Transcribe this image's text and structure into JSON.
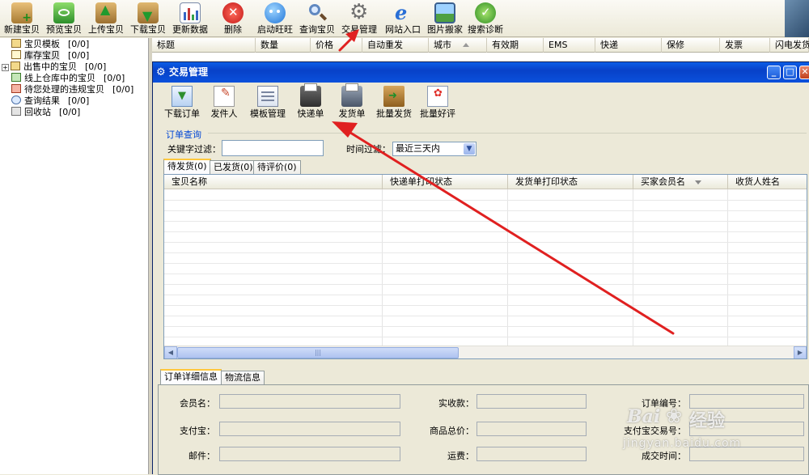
{
  "toolbar": {
    "buttons": [
      {
        "label": "新建宝贝",
        "icon": "new-item-icon"
      },
      {
        "label": "预览宝贝",
        "icon": "preview-icon"
      },
      {
        "label": "上传宝贝",
        "icon": "upload-icon"
      },
      {
        "label": "下载宝贝",
        "icon": "download-icon"
      },
      {
        "label": "更新数据",
        "icon": "update-data-icon"
      },
      {
        "label": "删除",
        "icon": "delete-icon"
      },
      {
        "label": "启动旺旺",
        "icon": "wangwang-icon"
      },
      {
        "label": "查询宝贝",
        "icon": "search-icon"
      },
      {
        "label": "交易管理",
        "icon": "gear-icon"
      },
      {
        "label": "网站入口",
        "icon": "ie-icon"
      },
      {
        "label": "图片搬家",
        "icon": "image-move-icon"
      },
      {
        "label": "搜索诊断",
        "icon": "diagnose-icon"
      }
    ]
  },
  "tree": {
    "items": [
      {
        "label": "宝贝模板",
        "count": "[0/0]"
      },
      {
        "label": "库存宝贝",
        "count": "[0/0]"
      },
      {
        "label": "出售中的宝贝",
        "count": "[0/0]"
      },
      {
        "label": "线上仓库中的宝贝",
        "count": "[0/0]"
      },
      {
        "label": "待您处理的违规宝贝",
        "count": "[0/0]"
      },
      {
        "label": "查询结果",
        "count": "[0/0]"
      },
      {
        "label": "回收站",
        "count": "[0/0]"
      }
    ]
  },
  "list_header": [
    "标题",
    "数量",
    "价格",
    "自动重发",
    "城市",
    "有效期",
    "EMS",
    "快递",
    "保修",
    "发票",
    "闪电发货"
  ],
  "dialog": {
    "title": "交易管理",
    "tools": [
      {
        "label": "下载订单",
        "icon": "download-order-icon"
      },
      {
        "label": "发件人",
        "icon": "sender-icon"
      },
      {
        "label": "模板管理",
        "icon": "template-icon"
      },
      {
        "label": "快递单",
        "icon": "express-print-icon"
      },
      {
        "label": "发货单",
        "icon": "invoice-print-icon"
      },
      {
        "label": "批量发货",
        "icon": "batch-ship-icon"
      },
      {
        "label": "批量好评",
        "icon": "batch-review-icon"
      }
    ],
    "query": {
      "group_label": "订单查询",
      "keyword_label": "关键字过滤：",
      "keyword_value": "",
      "time_label": "时间过滤：",
      "time_value": "最近三天内"
    },
    "tabs": [
      "待发货(0)",
      "已发货(0)",
      "待评价(0)"
    ],
    "grid_columns": [
      "宝贝名称",
      "快递单打印状态",
      "发货单打印状态",
      "买家会员名",
      "收货人姓名"
    ],
    "detail_tabs": [
      "订单详细信息",
      "物流信息"
    ],
    "detail_fields": {
      "col1": [
        "会员名：",
        "支付宝：",
        "邮件："
      ],
      "col2": [
        "实收款：",
        "商品总价：",
        "运费："
      ],
      "col3": [
        "订单编号：",
        "支付宝交易号：",
        "成交时间："
      ]
    }
  },
  "watermark": {
    "brand": "Bai",
    "site": "经验",
    "url": "jingyan.baidu.com"
  },
  "colors": {
    "annotation_arrow": "#e02020",
    "titlebar": "#0a50dc"
  }
}
